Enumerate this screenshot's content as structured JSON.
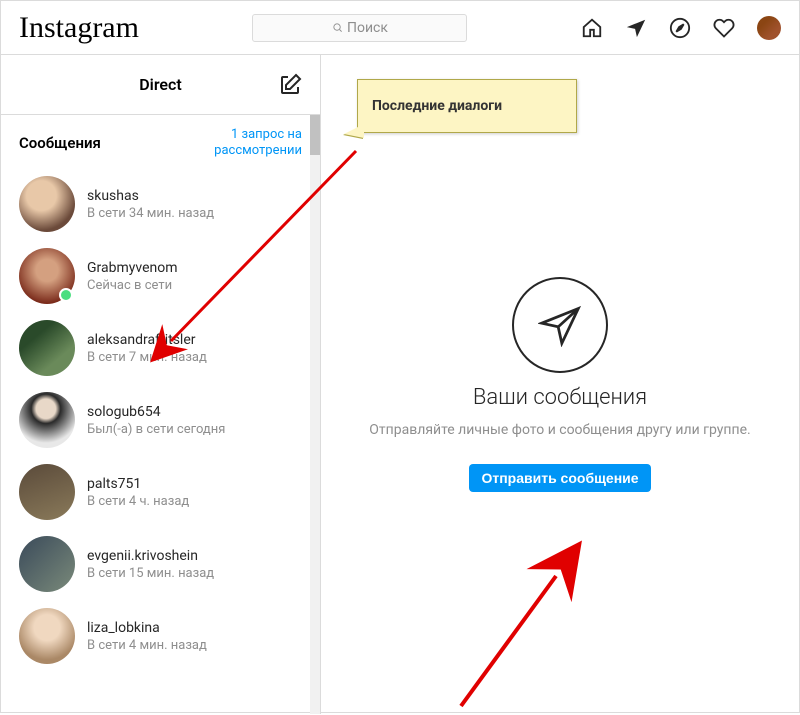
{
  "brand": "Instagram",
  "search": {
    "placeholder": "Поиск"
  },
  "sidebar": {
    "title": "Direct",
    "messages_label": "Сообщения",
    "requests_label": "1 запрос на\nрассмотрении",
    "items": [
      {
        "name": "skushas",
        "status": "В сети 34 мин. назад",
        "online": false
      },
      {
        "name": "Grabmyvenom",
        "status": "Сейчас в сети",
        "online": true
      },
      {
        "name": "aleksandrafritsler",
        "status": "В сети 7 мин. назад",
        "online": false
      },
      {
        "name": "sologub654",
        "status": "Был(-а) в сети сегодня",
        "online": false
      },
      {
        "name": "palts751",
        "status": "В сети 4 ч. назад",
        "online": false
      },
      {
        "name": "evgenii.krivoshein",
        "status": "В сети 15 мин. назад",
        "online": false
      },
      {
        "name": "liza_lobkina",
        "status": "В сети 4 мин. назад",
        "online": false
      }
    ]
  },
  "content": {
    "title": "Ваши сообщения",
    "subtitle": "Отправляйте личные фото и сообщения другу или группе.",
    "button": "Отправить сообщение"
  },
  "annotation": {
    "callout": "Последние диалоги"
  }
}
